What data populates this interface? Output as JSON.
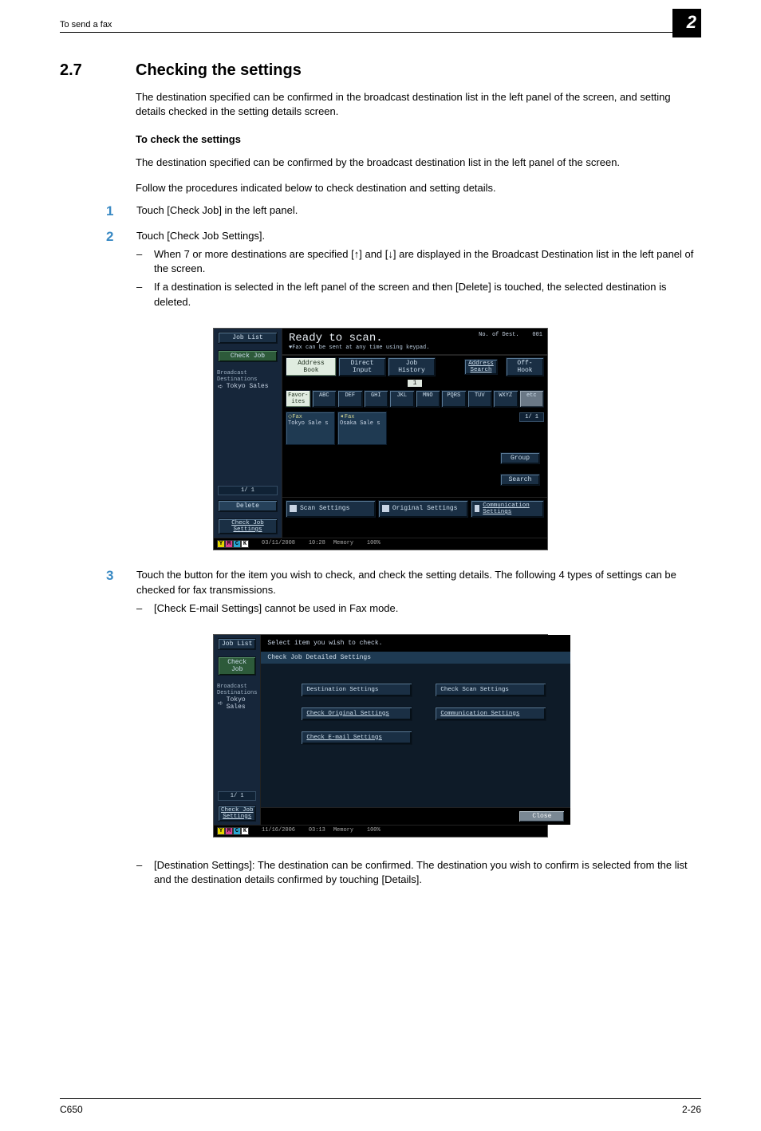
{
  "header": {
    "running_head": "To send a fax",
    "chapter_number": "2"
  },
  "section": {
    "number": "2.7",
    "title": "Checking the settings",
    "intro": "The destination specified can be confirmed in the broadcast destination list in the left panel of the screen, and setting details checked in the setting details screen.",
    "sub_title": "To check the settings",
    "sub_intro1": "The destination specified can be confirmed by the broadcast destination list in the left panel of the screen.",
    "sub_intro2": "Follow the procedures indicated below to check destination and setting details."
  },
  "steps": [
    {
      "num": "1",
      "text": "Touch [Check Job] in the left panel."
    },
    {
      "num": "2",
      "text": "Touch [Check Job Settings].",
      "bullets": [
        "When 7 or more destinations are specified [↑] and [↓] are displayed in the Broadcast Destination list in the left panel of the screen.",
        "If a destination is selected in the left panel of the screen and then [Delete] is touched, the selected destination is deleted."
      ]
    },
    {
      "num": "3",
      "text": "Touch the button for the item you wish to check, and check the setting details. The following 4 types of settings can be checked for fax transmissions.",
      "bullets": [
        "[Check E-mail Settings] cannot be used in Fax mode."
      ]
    }
  ],
  "post_bullets": [
    "[Destination Settings]: The destination can be confirmed. The destination you wish to confirm is selected from the list and the destination details confirmed by touching [Details]."
  ],
  "screenshot1": {
    "left": {
      "job_list": "Job List",
      "check_job": "Check Job",
      "broadcast_label": "Broadcast Destinations",
      "dest1": "Tokyo Sales",
      "page": "1/  1",
      "delete": "Delete",
      "check_job_settings": "Check Job Settings"
    },
    "head": {
      "title": "Ready to scan.",
      "subtitle": "♥Fax can be sent at any time using keypad.",
      "nodest_label": "No. of Dest.",
      "nodest_value": "001"
    },
    "tabs": {
      "address_book": "Address Book",
      "direct_input": "Direct Input",
      "job_history": "Job History",
      "address_search": "Address Search",
      "off_hook": "Off-Hook",
      "onebar": "1"
    },
    "abc": [
      "Favor- ites",
      "ABC",
      "DEF",
      "GHI",
      "JKL",
      "MNO",
      "PQRS",
      "TUV",
      "WXYZ",
      "etc"
    ],
    "cards": [
      {
        "icon": "◇Fax",
        "line": "Tokyo Sale s"
      },
      {
        "icon": "➧Fax",
        "line": "Osaka Sale s"
      }
    ],
    "rightcol": {
      "onebyone": "1/  1",
      "group": "Group",
      "search": "Search"
    },
    "bottom": {
      "scan": "Scan Settings",
      "original": "Original Settings",
      "comm": "Communication Settings"
    },
    "status": {
      "date": "03/11/2008",
      "time": "10:28",
      "mem_label": "Memory",
      "mem_value": "100%"
    }
  },
  "screenshot2": {
    "left": {
      "job_list": "Job List",
      "check_job": "Check Job",
      "broadcast_label": "Broadcast Destinations",
      "dest1": "Tokyo Sales",
      "page": "1/  1",
      "check_job_settings": "Check Job Settings"
    },
    "head": {
      "title": "Select item you wish to check."
    },
    "panel_title": "Check Job Detailed Settings",
    "options": {
      "dest": "Destination Settings",
      "scan": "Check Scan Settings",
      "orig": "Check Original Settings",
      "comm": "Communication Settings",
      "email": "Check E-mail Settings"
    },
    "close": "Close",
    "status": {
      "date": "11/16/2006",
      "time": "03:13",
      "mem_label": "Memory",
      "mem_value": "100%"
    }
  },
  "footer": {
    "left": "C650",
    "right": "2-26"
  }
}
